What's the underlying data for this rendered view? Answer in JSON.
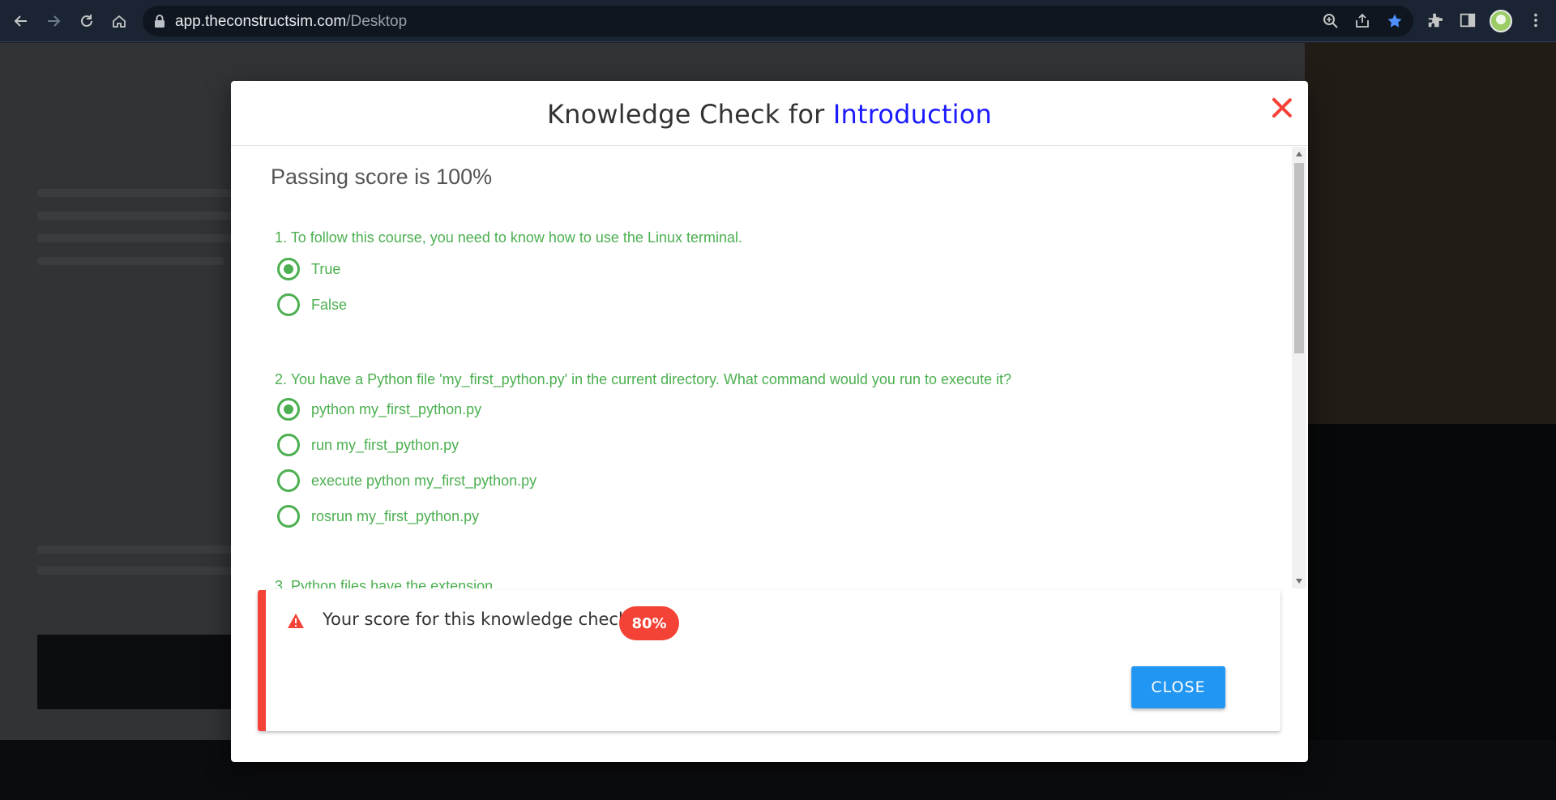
{
  "browser": {
    "url_host": "app.theconstructsim.com",
    "url_path": "/Desktop",
    "icons": [
      "back-icon",
      "forward-icon",
      "reload-icon",
      "home-icon",
      "lock-icon",
      "zoom-icon",
      "share-icon",
      "star-icon",
      "extensions-icon",
      "sidepanel-icon",
      "profile-avatar",
      "menu-icon"
    ]
  },
  "modal": {
    "title_prefix": "Knowledge Check for",
    "title_highlight": "Introduction",
    "passing_score": "Passing score is 100%",
    "questions": [
      {
        "text": "1. To follow this course, you need to know how to use the Linux terminal.",
        "options": [
          {
            "label": "True",
            "selected": true
          },
          {
            "label": "False",
            "selected": false
          }
        ]
      },
      {
        "text": "2. You have a Python file 'my_first_python.py' in the current directory. What command would you run to execute it?",
        "options": [
          {
            "label": "python my_first_python.py",
            "selected": true
          },
          {
            "label": "run my_first_python.py",
            "selected": false
          },
          {
            "label": "execute python my_first_python.py",
            "selected": false
          },
          {
            "label": "rosrun my_first_python.py",
            "selected": false
          }
        ]
      },
      {
        "text": "3. Python files have the extension"
      }
    ],
    "result": {
      "message": "Your score for this knowledge check:",
      "score": "80%",
      "close_label": "CLOSE"
    }
  },
  "colors": {
    "accent_green": "#4caf50",
    "title_highlight": "#1a1aff",
    "error_red": "#f44336",
    "button_blue": "#2196f3"
  }
}
